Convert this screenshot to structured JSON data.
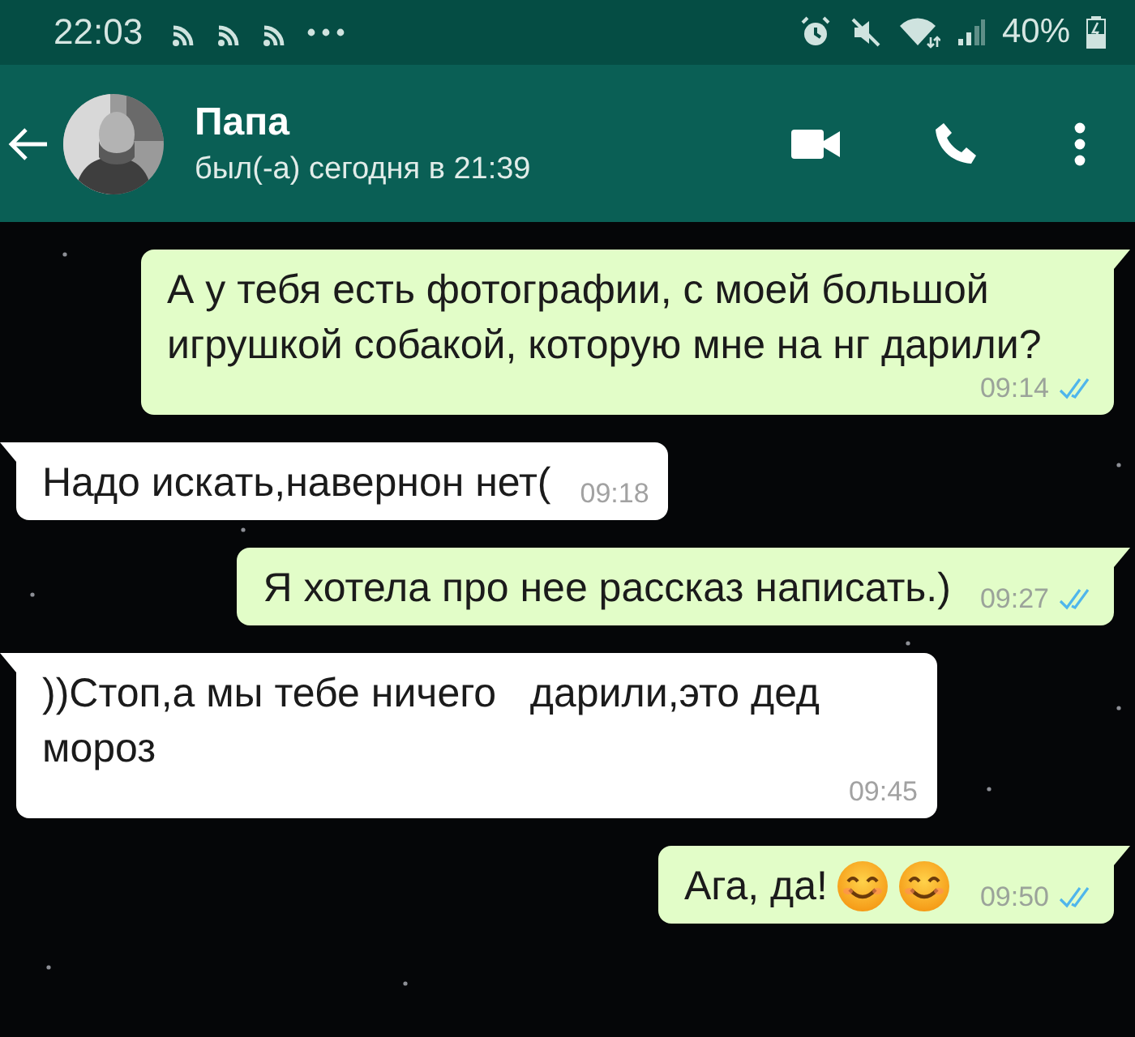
{
  "status_bar": {
    "time": "22:03",
    "battery": "40%"
  },
  "header": {
    "name": "Папа",
    "last_seen": "был(-а) сегодня в 21:39"
  },
  "messages": [
    {
      "kind": "outgoing",
      "text": "А у тебя есть фотографии, с моей большой игрушкой собакой, которую мне на нг дарили?",
      "time": "09:14",
      "read": true
    },
    {
      "kind": "incoming",
      "text": "Надо искать,навернон нет(",
      "time": "09:18"
    },
    {
      "kind": "outgoing",
      "text": "Я хотела про нее рассказ написать.)",
      "time": "09:27",
      "read": true
    },
    {
      "kind": "incoming",
      "text": "))Стоп,а мы тебе ничего   дарили,это дед мороз",
      "time": "09:45"
    },
    {
      "kind": "outgoing",
      "text": "Ага, да!",
      "emoji": [
        {
          "kind": "smile"
        },
        {
          "kind": "smile"
        }
      ],
      "time": "09:50",
      "read": true
    }
  ]
}
